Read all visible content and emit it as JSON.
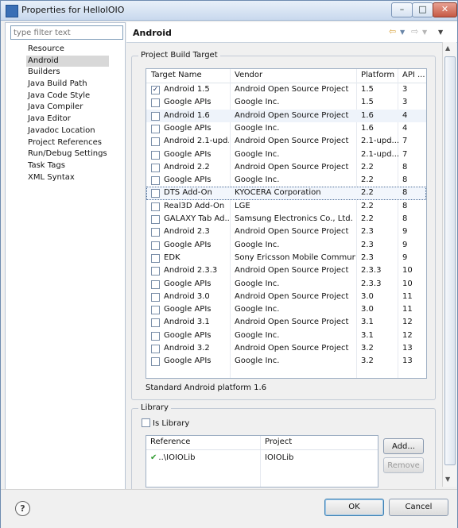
{
  "window": {
    "title": "Properties for HelloIOIO",
    "min": "–",
    "max": "□",
    "close": "✕"
  },
  "filter": {
    "placeholder": "type filter text"
  },
  "nav": [
    "Resource",
    "Android",
    "Builders",
    "Java Build Path",
    "Java Code Style",
    "Java Compiler",
    "Java Editor",
    "Javadoc Location",
    "Project References",
    "Run/Debug Settings",
    "Task Tags",
    "XML Syntax"
  ],
  "nav_selected": "Android",
  "page": {
    "title": "Android"
  },
  "build_target": {
    "group_label": "Project Build Target",
    "columns": [
      "Target Name",
      "Vendor",
      "Platform",
      "API ..."
    ],
    "rows": [
      {
        "name": "Android 1.5",
        "vendor": "Android Open Source Project",
        "platform": "1.5",
        "api": "3",
        "checked": true
      },
      {
        "name": "Google APIs",
        "vendor": "Google Inc.",
        "platform": "1.5",
        "api": "3",
        "checked": false
      },
      {
        "name": "Android 1.6",
        "vendor": "Android Open Source Project",
        "platform": "1.6",
        "api": "4",
        "checked": false
      },
      {
        "name": "Google APIs",
        "vendor": "Google Inc.",
        "platform": "1.6",
        "api": "4",
        "checked": false
      },
      {
        "name": "Android 2.1-upd...",
        "vendor": "Android Open Source Project",
        "platform": "2.1-upd...",
        "api": "7",
        "checked": false
      },
      {
        "name": "Google APIs",
        "vendor": "Google Inc.",
        "platform": "2.1-upd...",
        "api": "7",
        "checked": false
      },
      {
        "name": "Android 2.2",
        "vendor": "Android Open Source Project",
        "platform": "2.2",
        "api": "8",
        "checked": false
      },
      {
        "name": "Google APIs",
        "vendor": "Google Inc.",
        "platform": "2.2",
        "api": "8",
        "checked": false
      },
      {
        "name": "DTS Add-On",
        "vendor": "KYOCERA Corporation",
        "platform": "2.2",
        "api": "8",
        "checked": false
      },
      {
        "name": "Real3D Add-On",
        "vendor": "LGE",
        "platform": "2.2",
        "api": "8",
        "checked": false
      },
      {
        "name": "GALAXY Tab Ad...",
        "vendor": "Samsung Electronics Co., Ltd.",
        "platform": "2.2",
        "api": "8",
        "checked": false
      },
      {
        "name": "Android 2.3",
        "vendor": "Android Open Source Project",
        "platform": "2.3",
        "api": "9",
        "checked": false
      },
      {
        "name": "Google APIs",
        "vendor": "Google Inc.",
        "platform": "2.3",
        "api": "9",
        "checked": false
      },
      {
        "name": "EDK",
        "vendor": "Sony Ericsson Mobile Communi...",
        "platform": "2.3",
        "api": "9",
        "checked": false
      },
      {
        "name": "Android 2.3.3",
        "vendor": "Android Open Source Project",
        "platform": "2.3.3",
        "api": "10",
        "checked": false
      },
      {
        "name": "Google APIs",
        "vendor": "Google Inc.",
        "platform": "2.3.3",
        "api": "10",
        "checked": false
      },
      {
        "name": "Android 3.0",
        "vendor": "Android Open Source Project",
        "platform": "3.0",
        "api": "11",
        "checked": false
      },
      {
        "name": "Google APIs",
        "vendor": "Google Inc.",
        "platform": "3.0",
        "api": "11",
        "checked": false
      },
      {
        "name": "Android 3.1",
        "vendor": "Android Open Source Project",
        "platform": "3.1",
        "api": "12",
        "checked": false
      },
      {
        "name": "Google APIs",
        "vendor": "Google Inc.",
        "platform": "3.1",
        "api": "12",
        "checked": false
      },
      {
        "name": "Android 3.2",
        "vendor": "Android Open Source Project",
        "platform": "3.2",
        "api": "13",
        "checked": false
      },
      {
        "name": "Google APIs",
        "vendor": "Google Inc.",
        "platform": "3.2",
        "api": "13",
        "checked": false
      }
    ],
    "highlighted_row": "Android 1.6",
    "focused_row": "DTS Add-On",
    "description": "Standard Android platform 1.6"
  },
  "library": {
    "group_label": "Library",
    "is_library_label": "Is Library",
    "columns": [
      "Reference",
      "Project"
    ],
    "rows": [
      {
        "reference": "..\\IOIOLib",
        "project": "IOIOLib",
        "status_icon": "check-icon"
      }
    ],
    "add_label": "Add...",
    "remove_label": "Remove"
  },
  "footer": {
    "ok_label": "OK",
    "cancel_label": "Cancel",
    "help": "?"
  }
}
